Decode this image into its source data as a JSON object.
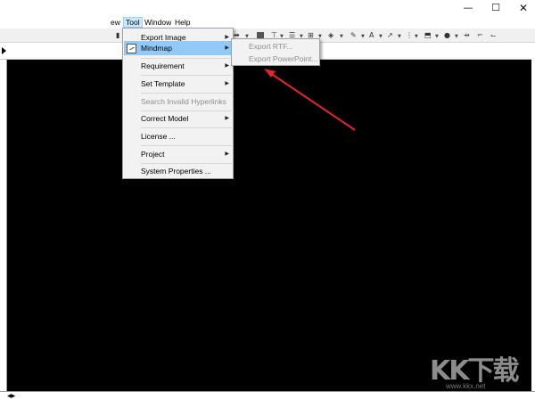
{
  "window": {
    "controls": [
      "—",
      "☐",
      "✕"
    ]
  },
  "menubar": {
    "items": [
      "ew",
      "Tool",
      "Window",
      "Help"
    ]
  },
  "tool_menu": {
    "items": [
      {
        "label": "Export Image",
        "submenu": true,
        "enabled": true
      },
      {
        "label": "Mindmap",
        "submenu": true,
        "enabled": true,
        "highlighted": true
      },
      {
        "label": "Requirement",
        "submenu": true,
        "enabled": true
      },
      {
        "label": "Set Template",
        "submenu": true,
        "enabled": true
      },
      {
        "label": "Search Invalid Hyperlinks",
        "submenu": false,
        "enabled": false
      },
      {
        "label": "Correct Model",
        "submenu": true,
        "enabled": true
      },
      {
        "label": "License ...",
        "submenu": false,
        "enabled": true
      },
      {
        "label": "Project",
        "submenu": true,
        "enabled": true
      },
      {
        "label": "System Properties ...",
        "submenu": false,
        "enabled": true
      }
    ]
  },
  "mindmap_submenu": {
    "items": [
      {
        "label": "Export RTF...",
        "enabled": false
      },
      {
        "label": "Export PowerPoint...",
        "enabled": false
      }
    ]
  },
  "status": {
    "arrows": "◀▶"
  },
  "watermark": {
    "main": "KK下载",
    "sub": "www.kkx.net"
  },
  "colors": {
    "canvas": "#000000",
    "highlight": "#91c9f7",
    "annotation_arrow": "#e3262b"
  }
}
